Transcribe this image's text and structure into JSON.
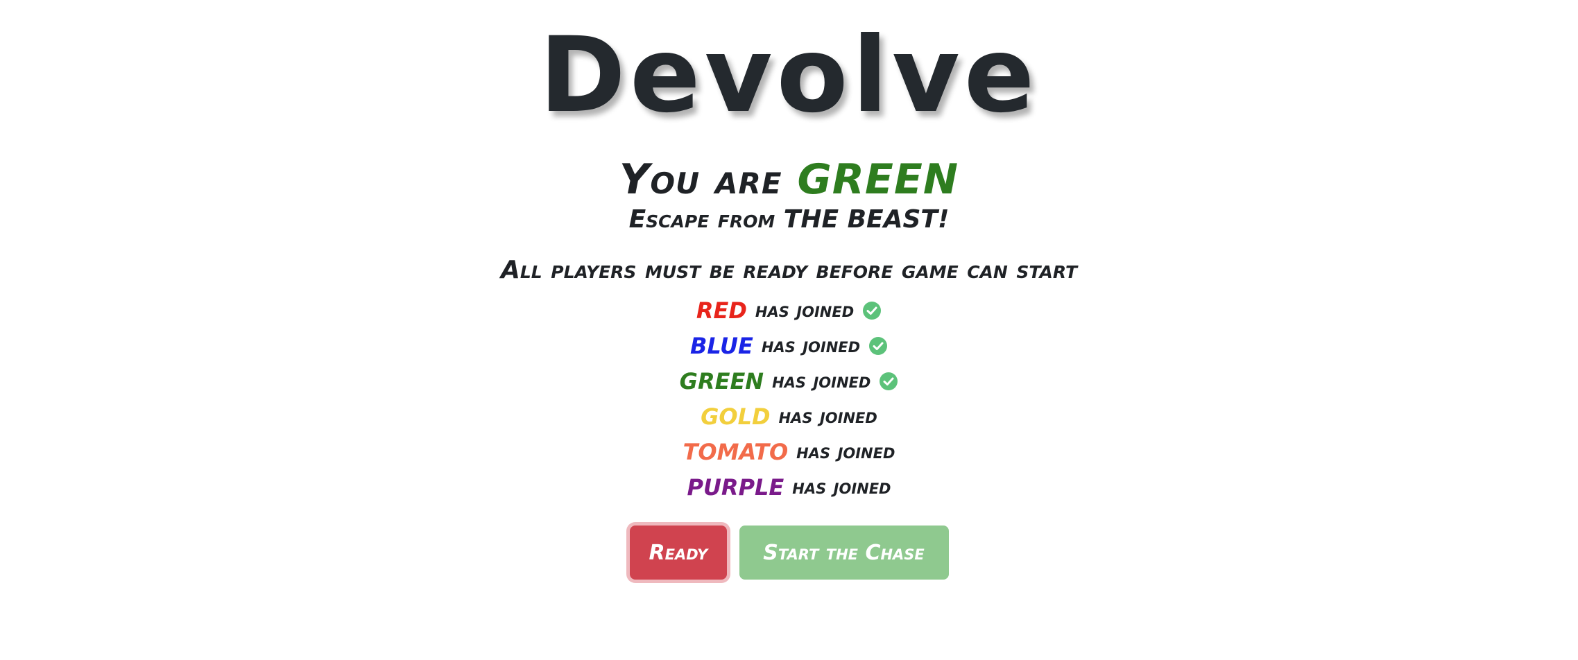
{
  "game": {
    "title": "Devolve"
  },
  "player": {
    "prefix": "You are ",
    "color_name": "GREEN",
    "color_hex": "#2e7d1f",
    "role_text": "Escape from THE BEAST!"
  },
  "lobby": {
    "notice": "All players must be ready before game can start",
    "joined_suffix": "has joined",
    "players": [
      {
        "name": "RED",
        "color": "#e8241b",
        "ready": true
      },
      {
        "name": "BLUE",
        "color": "#1a24e6",
        "ready": true
      },
      {
        "name": "GREEN",
        "color": "#2e7d1f",
        "ready": true
      },
      {
        "name": "GOLD",
        "color": "#f2cf3d",
        "ready": false
      },
      {
        "name": "TOMATO",
        "color": "#f26b4a",
        "ready": false
      },
      {
        "name": "PURPLE",
        "color": "#7a1a8a",
        "ready": false
      }
    ]
  },
  "controls": {
    "ready_label": "Ready",
    "start_label": "Start the Chase"
  },
  "colors": {
    "check_green": "#5cc27a",
    "ready_button": "#d0434f",
    "start_button": "#8fc98f"
  },
  "icons": {
    "check": "check-circle-icon"
  }
}
